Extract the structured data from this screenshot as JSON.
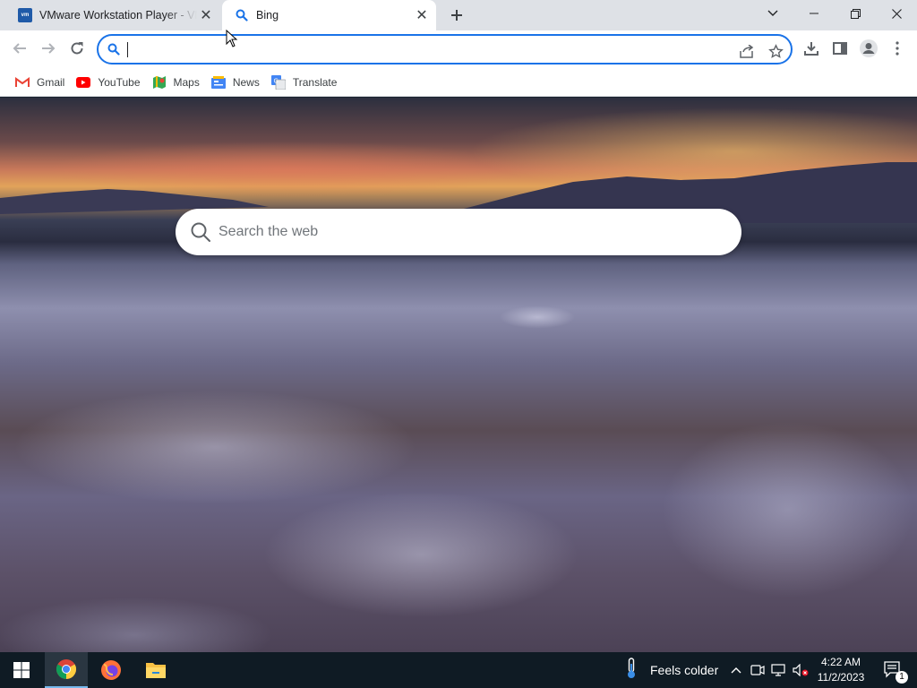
{
  "browser": {
    "tabs": [
      {
        "title": "VMware Workstation Player - VMware",
        "favicon": "vmware-icon",
        "active": false
      },
      {
        "title": "Bing",
        "favicon": "bing-search-icon",
        "active": true
      }
    ],
    "address_bar": {
      "value": "",
      "placeholder": ""
    },
    "bookmarks": [
      {
        "label": "Gmail",
        "icon": "gmail-icon"
      },
      {
        "label": "YouTube",
        "icon": "youtube-icon"
      },
      {
        "label": "Maps",
        "icon": "maps-icon"
      },
      {
        "label": "News",
        "icon": "news-icon"
      },
      {
        "label": "Translate",
        "icon": "translate-icon"
      }
    ]
  },
  "page": {
    "search": {
      "placeholder": "Search the web",
      "value": ""
    }
  },
  "taskbar": {
    "apps": [
      "chrome-icon",
      "firefox-icon",
      "file-explorer-icon"
    ],
    "weather": {
      "text": "Feels colder",
      "icon": "thermometer-icon"
    },
    "clock": {
      "time": "4:22 AM",
      "date": "11/2/2023"
    },
    "notification_count": "1"
  },
  "colors": {
    "accent": "#1a73e8",
    "tabstrip": "#dee1e6",
    "taskbar": "#0f1b24"
  }
}
